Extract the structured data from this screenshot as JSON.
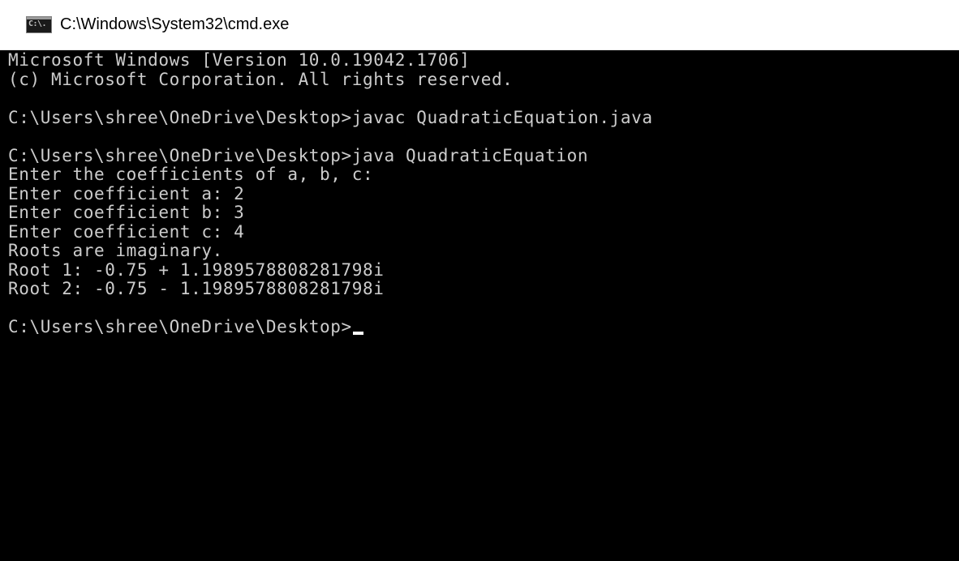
{
  "window": {
    "title": "C:\\Windows\\System32\\cmd.exe",
    "app_icon": "cmd-icon",
    "icon_text": "C:\\."
  },
  "console": {
    "lines": [
      "Microsoft Windows [Version 10.0.19042.1706]",
      "(c) Microsoft Corporation. All rights reserved.",
      "",
      "C:\\Users\\shree\\OneDrive\\Desktop>javac QuadraticEquation.java",
      "",
      "C:\\Users\\shree\\OneDrive\\Desktop>java QuadraticEquation",
      "Enter the coefficients of a, b, c:",
      "Enter coefficient a: 2",
      "Enter coefficient b: 3",
      "Enter coefficient c: 4",
      "Roots are imaginary.",
      "Root 1: -0.75 + 1.1989578808281798i",
      "Root 2: -0.75 - 1.1989578808281798i",
      ""
    ],
    "current_prompt": "C:\\Users\\shree\\OneDrive\\Desktop>"
  },
  "colors": {
    "background": "#000000",
    "text": "#cccccc",
    "titlebar": "#ffffff"
  }
}
